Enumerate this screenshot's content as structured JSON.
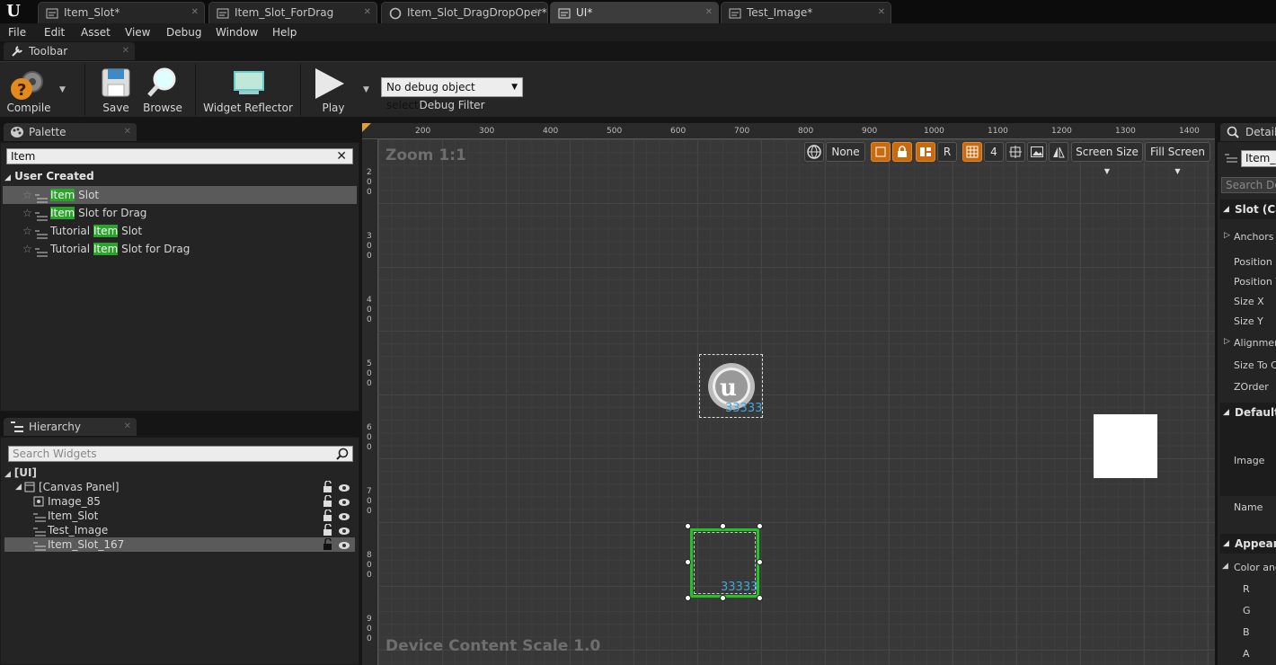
{
  "tabs": [
    {
      "label": "Item_Slot*"
    },
    {
      "label": "Item_Slot_ForDrag"
    },
    {
      "label": "Item_Slot_DragDropOper*"
    },
    {
      "label": "UI*"
    },
    {
      "label": "Test_Image*"
    }
  ],
  "menu": {
    "items": [
      "File",
      "Edit",
      "Asset",
      "View",
      "Debug",
      "Window",
      "Help"
    ]
  },
  "toolbar": {
    "tab_label": "Toolbar",
    "compile": "Compile",
    "save": "Save",
    "browse": "Browse",
    "widget_reflector": "Widget Reflector",
    "play": "Play",
    "debug_object": "No debug object selected",
    "debug_filter": "Debug Filter"
  },
  "palette": {
    "tab_label": "Palette",
    "search_value": "Item",
    "category": "User Created",
    "items": [
      {
        "pre": "",
        "match": "Item",
        "post": " Slot"
      },
      {
        "pre": "",
        "match": "Item",
        "post": " Slot for Drag"
      },
      {
        "pre": "Tutorial ",
        "match": "Item",
        "post": " Slot"
      },
      {
        "pre": "Tutorial ",
        "match": "Item",
        "post": " Slot for Drag"
      }
    ]
  },
  "hierarchy": {
    "tab_label": "Hierarchy",
    "search_placeholder": "Search Widgets",
    "root": "[UI]",
    "canvas": "[Canvas Panel]",
    "children": [
      "Image_85",
      "Item_Slot",
      "Test_Image",
      "Item_Slot_167"
    ]
  },
  "designer": {
    "zoom": "Zoom 1:1",
    "device_scale": "Device Content Scale 1.0",
    "ruler_x": [
      "200",
      "300",
      "400",
      "500",
      "600",
      "700",
      "800",
      "900",
      "1000",
      "1100",
      "1200",
      "1300",
      "1400"
    ],
    "ruler_y": [
      "200",
      "300",
      "400",
      "500",
      "600",
      "700",
      "800",
      "900"
    ],
    "none_label": "None",
    "r_label": "R",
    "grid_snap": "4",
    "screen_size": "Screen Size",
    "fill_screen": "Fill Screen",
    "count_text": "33333"
  },
  "details": {
    "tab_label": "Details",
    "name_value": "Item_S",
    "search_placeholder": "Search Det",
    "sections": {
      "slot": "Slot (Can",
      "default": "Default",
      "appearance": "Appeara"
    },
    "labels": {
      "anchors": "Anchors",
      "position_x": "Position X",
      "position_y": "Position Y",
      "size_x": "Size X",
      "size_y": "Size Y",
      "alignment": "Alignmen",
      "size_to_content": "Size To C",
      "zorder": "ZOrder",
      "image": "Image",
      "name": "Name",
      "color": "Color and",
      "r": "R",
      "g": "G",
      "b": "B",
      "a": "A"
    }
  },
  "colors": {
    "accent_orange": "#c76a10",
    "search_highlight": "#29a329",
    "selection_green": "#22c322",
    "count_text": "#3fa9d8"
  }
}
